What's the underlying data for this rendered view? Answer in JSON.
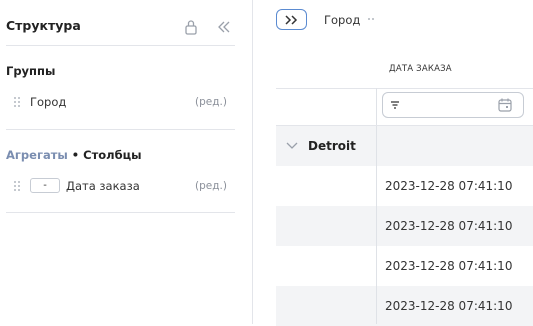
{
  "sidebar": {
    "title": "Структура",
    "groups": {
      "title": "Группы",
      "items": [
        {
          "label": "Город",
          "edit": "(ред.)"
        }
      ]
    },
    "aggregates": {
      "title_part1": "Агрегаты",
      "separator": " • ",
      "title_part2": "Столбцы",
      "items": [
        {
          "agg": "-",
          "label": "Дата заказа",
          "edit": "(ред.)"
        }
      ]
    }
  },
  "toolbar": {
    "expand_label": ">>",
    "group_chip": "Город"
  },
  "table": {
    "column_header": "ДАТА ЗАКАЗА",
    "group_value": "Detroit",
    "rows": [
      "2023-12-28 07:41:10",
      "2023-12-28 07:41:10",
      "2023-12-28 07:41:10",
      "2023-12-28 07:41:10"
    ]
  },
  "colors": {
    "accent": "#5b8bd1",
    "stripe": "#f3f4f6",
    "divider": "#e3e5ea",
    "muted_link": "#8a8f99"
  }
}
